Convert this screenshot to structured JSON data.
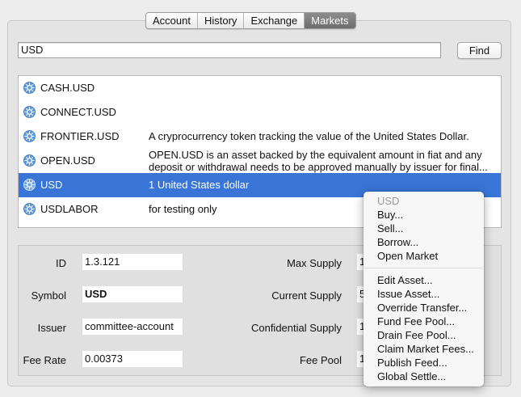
{
  "tabs": [
    {
      "label": "Account"
    },
    {
      "label": "History"
    },
    {
      "label": "Exchange"
    },
    {
      "label": "Markets"
    }
  ],
  "search": {
    "value": "USD"
  },
  "find_label": "Find",
  "assets": [
    {
      "symbol": "CASH.USD",
      "description": ""
    },
    {
      "symbol": "CONNECT.USD",
      "description": ""
    },
    {
      "symbol": "FRONTIER.USD",
      "description": "A cryprocurrency token tracking the value of the United States Dollar."
    },
    {
      "symbol": "OPEN.USD",
      "description_lines": [
        "OPEN.USD is an asset backed by the equivalent amount in fiat and any",
        "deposit or withdrawal needs to be approved manually by issuer for final..."
      ]
    },
    {
      "symbol": "USD",
      "description": "1 United States dollar"
    },
    {
      "symbol": "USDLABOR",
      "description": "for testing only"
    }
  ],
  "details": {
    "id_label": "ID",
    "id_value": "1.3.121",
    "symbol_label": "Symbol",
    "symbol_value": "USD",
    "issuer_label": "Issuer",
    "issuer_value": "committee-account",
    "fee_rate_label": "Fee Rate",
    "fee_rate_value": "0.00373",
    "max_supply_label": "Max Supply",
    "max_supply_value": "1",
    "current_supply_label": "Current Supply",
    "current_supply_value": "5",
    "confidential_supply_label": "Confidential Supply",
    "confidential_supply_value": "1",
    "fee_pool_label": "Fee Pool",
    "fee_pool_value": "1"
  },
  "context_menu": {
    "header": "USD",
    "group1": [
      "Buy...",
      "Sell...",
      "Borrow...",
      "Open Market"
    ],
    "group2": [
      "Edit Asset...",
      "Issue Asset...",
      "Override Transfer...",
      "Fund Fee Pool...",
      "Drain Fee Pool...",
      "Claim Market Fees...",
      "Publish Feed...",
      "Global Settle..."
    ]
  },
  "colors": {
    "selection": "#3875d7",
    "icon": "#4a90d9"
  }
}
